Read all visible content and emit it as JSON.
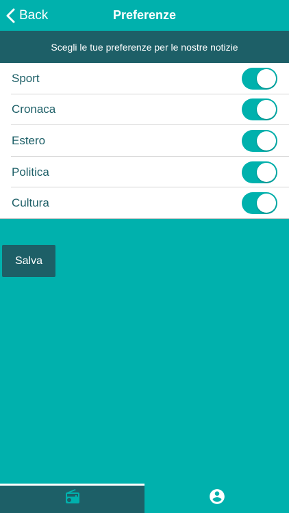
{
  "navbar": {
    "back_label": "Back",
    "title": "Preferenze"
  },
  "subheader": "Scegli le tue preferenze per le nostre notizie",
  "preferences": [
    {
      "label": "Sport",
      "enabled": true
    },
    {
      "label": "Cronaca",
      "enabled": true
    },
    {
      "label": "Estero",
      "enabled": true
    },
    {
      "label": "Politica",
      "enabled": true
    },
    {
      "label": "Cultura",
      "enabled": true
    }
  ],
  "save_label": "Salva",
  "tabs": [
    {
      "icon": "radio-icon",
      "active": true
    },
    {
      "icon": "account-circle-icon",
      "active": false
    }
  ],
  "colors": {
    "primary": "#00b1ad",
    "dark": "#1d5f67",
    "white": "#ffffff"
  }
}
